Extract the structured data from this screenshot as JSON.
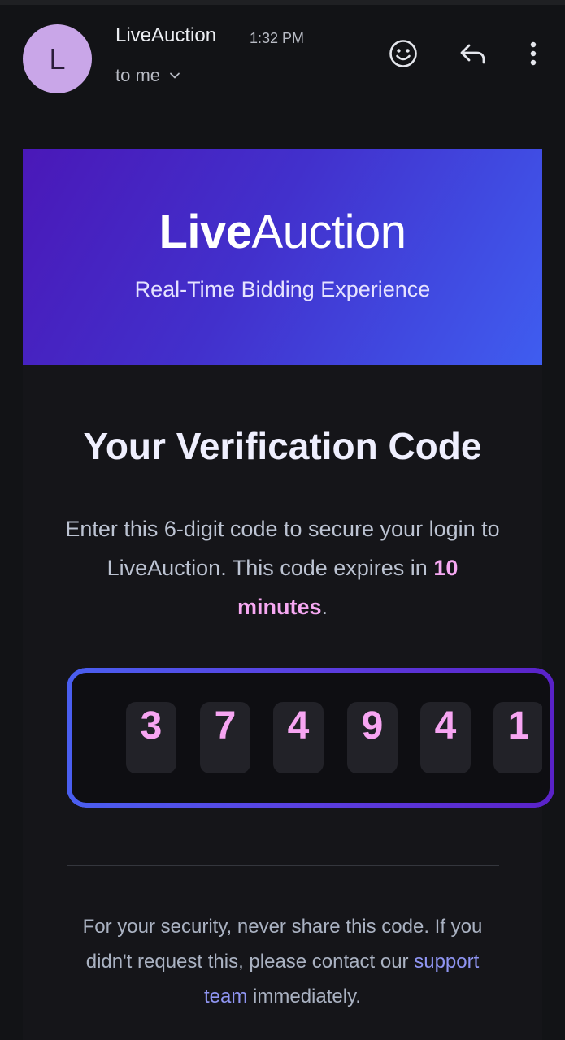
{
  "header": {
    "avatar_letter": "L",
    "sender": "LiveAuction",
    "time": "1:32 PM",
    "recipient": "to me",
    "icons": [
      "emoji-icon",
      "reply-icon",
      "more-vert-icon"
    ]
  },
  "banner": {
    "brand_bold": "Live",
    "brand_regular": "Auction",
    "tagline": "Real-Time Bidding Experience",
    "gradient_start": "#4a18b8",
    "gradient_end": "#3f5df0"
  },
  "content": {
    "title": "Your Verification Code",
    "intro_before": "Enter this 6-digit code to secure your login to LiveAuction. This code expires in ",
    "intro_highlight": "10 minutes",
    "intro_after": ".",
    "code_digits": [
      "3",
      "7",
      "4",
      "9",
      "4",
      "1"
    ],
    "footer_before": "For your security, never share this code. If you didn't request this, please contact our ",
    "footer_link": "support team",
    "footer_after": " immediately."
  },
  "colors": {
    "background": "#121316",
    "accent_pink": "#f6a8f2",
    "link": "#8f95f2"
  }
}
